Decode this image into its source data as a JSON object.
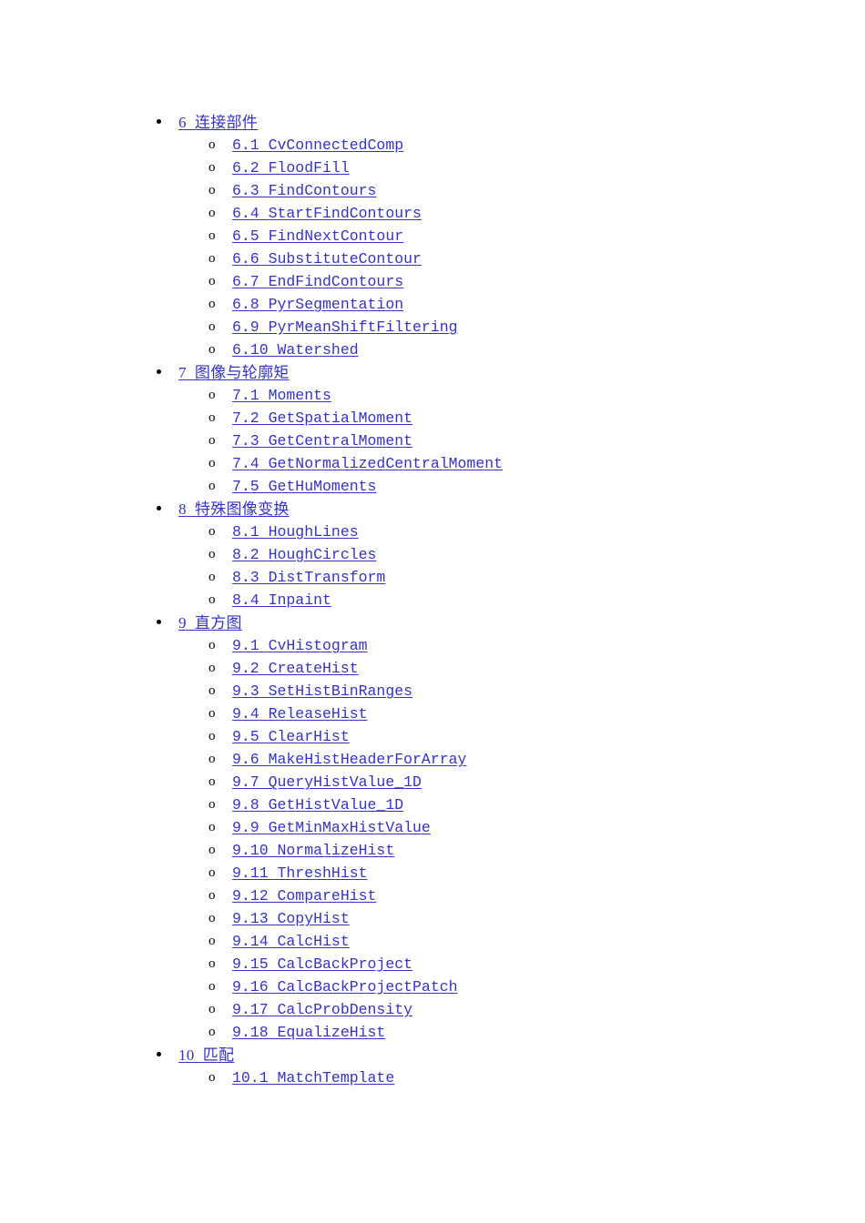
{
  "document": {
    "background_color": "#ffffff",
    "link_color": "#3333cc",
    "marker_color": "#000000",
    "top_level_marker": "disc",
    "sub_level_marker": "o"
  },
  "toc": {
    "chapters": [
      {
        "label": "6  连接部件",
        "sections": [
          {
            "label": "6.1 CvConnectedComp"
          },
          {
            "label": "6.2 FloodFill"
          },
          {
            "label": "6.3 FindContours"
          },
          {
            "label": "6.4 StartFindContours"
          },
          {
            "label": "6.5 FindNextContour"
          },
          {
            "label": "6.6 SubstituteContour"
          },
          {
            "label": "6.7 EndFindContours"
          },
          {
            "label": "6.8 PyrSegmentation"
          },
          {
            "label": "6.9 PyrMeanShiftFiltering"
          },
          {
            "label": "6.10 Watershed"
          }
        ]
      },
      {
        "label": "7  图像与轮廓矩",
        "sections": [
          {
            "label": "7.1 Moments"
          },
          {
            "label": "7.2 GetSpatialMoment"
          },
          {
            "label": "7.3 GetCentralMoment"
          },
          {
            "label": "7.4 GetNormalizedCentralMoment"
          },
          {
            "label": "7.5 GetHuMoments"
          }
        ]
      },
      {
        "label": "8  特殊图像变换",
        "sections": [
          {
            "label": "8.1 HoughLines"
          },
          {
            "label": "8.2 HoughCircles"
          },
          {
            "label": "8.3 DistTransform"
          },
          {
            "label": "8.4 Inpaint"
          }
        ]
      },
      {
        "label": "9  直方图",
        "sections": [
          {
            "label": "9.1 CvHistogram"
          },
          {
            "label": "9.2 CreateHist"
          },
          {
            "label": "9.3 SetHistBinRanges"
          },
          {
            "label": "9.4 ReleaseHist"
          },
          {
            "label": "9.5 ClearHist"
          },
          {
            "label": "9.6 MakeHistHeaderForArray"
          },
          {
            "label": "9.7 QueryHistValue_1D"
          },
          {
            "label": "9.8 GetHistValue_1D"
          },
          {
            "label": "9.9 GetMinMaxHistValue"
          },
          {
            "label": "9.10 NormalizeHist"
          },
          {
            "label": "9.11 ThreshHist"
          },
          {
            "label": "9.12 CompareHist"
          },
          {
            "label": "9.13 CopyHist"
          },
          {
            "label": "9.14 CalcHist"
          },
          {
            "label": "9.15 CalcBackProject"
          },
          {
            "label": "9.16 CalcBackProjectPatch"
          },
          {
            "label": "9.17 CalcProbDensity"
          },
          {
            "label": "9.18 EqualizeHist"
          }
        ]
      },
      {
        "label": "10  匹配",
        "sections": [
          {
            "label": "10.1 MatchTemplate"
          }
        ]
      }
    ]
  }
}
